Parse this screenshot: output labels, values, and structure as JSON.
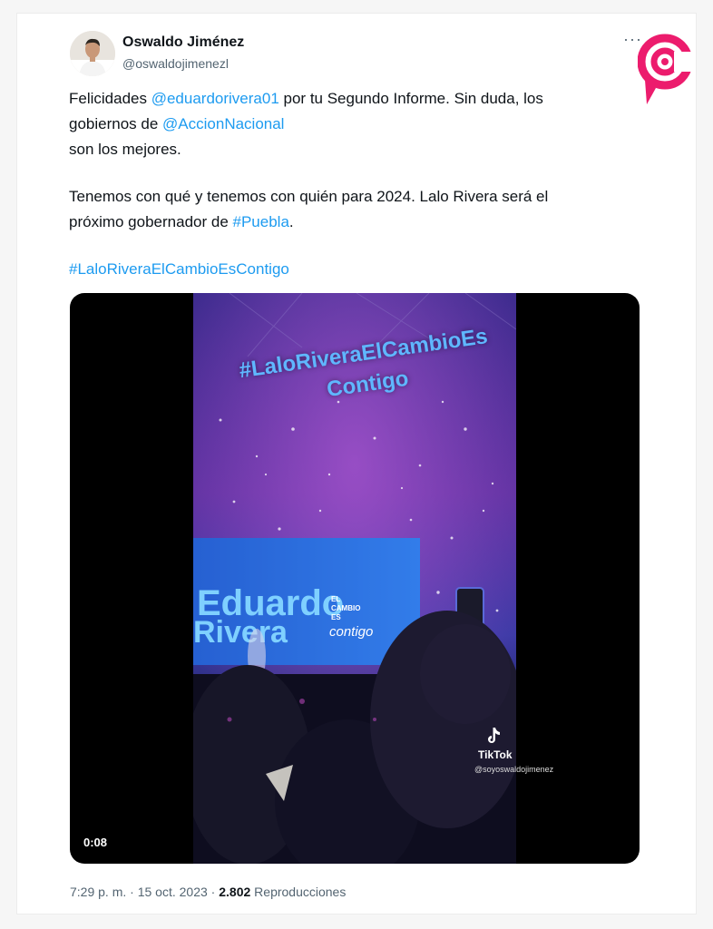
{
  "author": {
    "name": "Oswaldo Jiménez",
    "handle": "@oswaldojimenezl"
  },
  "tweet": {
    "line1_prefix": "Felicidades ",
    "mention1": "@eduardorivera01",
    "line1_suffix": " por tu Segundo Informe. Sin duda, los",
    "line2_prefix": "gobiernos de ",
    "mention2": "@AccionNacional",
    "line3": "son los mejores.",
    "para2_line1": "Tenemos con qué y tenemos con quién para 2024. Lalo Rivera será el",
    "para2_line2_prefix": "próximo gobernador de ",
    "hashtag_puebla": "#Puebla",
    "para2_line2_suffix": ".",
    "hashtag_main": "#LaloRiveraElCambioEsContigo"
  },
  "video": {
    "overlay_line1": "#LaloRiveraElCambioEs",
    "overlay_line2": "Contigo",
    "stage_name_line1": "Eduardo",
    "stage_name_line2": "Rivera",
    "stage_slogan_line1": "EL",
    "stage_slogan_line2": "CAMBIO",
    "stage_slogan_line3": "ES",
    "stage_slogan_line4": "contigo",
    "duration": "0:08",
    "watermark_name": "TikTok",
    "watermark_user": "@soyoswaldojimenez"
  },
  "footer": {
    "time": "7:29 p. m.",
    "separator": " · ",
    "date": "15 oct. 2023",
    "views_count": "2.802",
    "views_label": " Reproducciones"
  },
  "colors": {
    "link": "#1d9bf0",
    "brand_logo": "#ec1c6d",
    "text": "#0f1419",
    "muted": "#536471"
  },
  "icons": {
    "more": "more-options-icon",
    "brand": "brand-logo-icon",
    "tiktok": "tiktok-icon"
  }
}
